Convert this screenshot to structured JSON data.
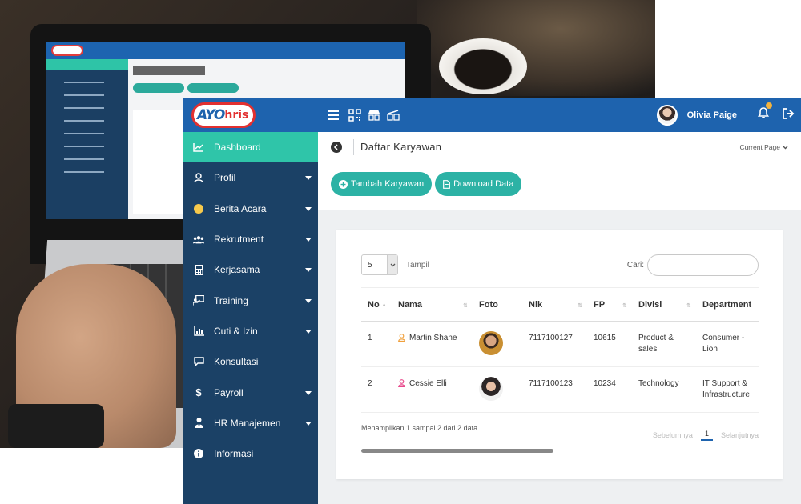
{
  "topbar": {
    "logo_ayo": "AYO",
    "logo_hris": "hris",
    "user_name": "Olivia Paige"
  },
  "sidebar": {
    "items": [
      {
        "label": "Dashboard",
        "icon": "chart-icon",
        "caret": false,
        "active": true
      },
      {
        "label": "Profil",
        "icon": "user-icon",
        "caret": true
      },
      {
        "label": "Berita Acara",
        "icon": "moon-icon",
        "caret": true
      },
      {
        "label": "Rekrutment",
        "icon": "users-icon",
        "caret": true
      },
      {
        "label": "Kerjasama",
        "icon": "calculator-icon",
        "caret": true
      },
      {
        "label": "Training",
        "icon": "training-icon",
        "caret": true
      },
      {
        "label": "Cuti & Izin",
        "icon": "chart-icon",
        "caret": true
      },
      {
        "label": "Konsultasi",
        "icon": "comment-icon",
        "caret": false
      },
      {
        "label": "Payroll",
        "icon": "dollar-icon",
        "caret": true
      },
      {
        "label": "HR Manajemen",
        "icon": "user-tie-icon",
        "caret": true
      },
      {
        "label": "Informasi",
        "icon": "info-icon",
        "caret": false
      }
    ]
  },
  "header": {
    "title": "Daftar Karyawan",
    "current_page": "Current Page"
  },
  "actions": {
    "add_label": "Tambah Karyawan",
    "download_label": "Download Data"
  },
  "table_controls": {
    "page_size": "5",
    "tampil": "Tampil",
    "search_label": "Cari:",
    "search_value": ""
  },
  "table": {
    "columns": [
      "No",
      "Nama",
      "Foto",
      "Nik",
      "FP",
      "Divisi",
      "Department"
    ],
    "rows": [
      {
        "no": "1",
        "nama": "Martin Shane",
        "nik": "7117100127",
        "fp": "10615",
        "divisi_1": "Product &",
        "divisi_2": "sales",
        "dept_1": "Consumer -",
        "dept_2": "Lion",
        "gender_color": "#f0a03c"
      },
      {
        "no": "2",
        "nama": "Cessie Elli",
        "nik": "7117100123",
        "fp": "10234",
        "divisi_1": "Technology",
        "divisi_2": "",
        "dept_1": "IT Support &",
        "dept_2": "Infrastructure",
        "gender_color": "#e84a8c"
      }
    ],
    "info": "Menampilkan 1 sampai 2 dari 2 data",
    "prev": "Sebelumnya",
    "page": "1",
    "next": "Selanjutnya"
  },
  "colors": {
    "topbar": "#1e63ae",
    "sidebar": "#1b4166",
    "accent": "#2fc5a9",
    "button": "#2cb2a5"
  }
}
